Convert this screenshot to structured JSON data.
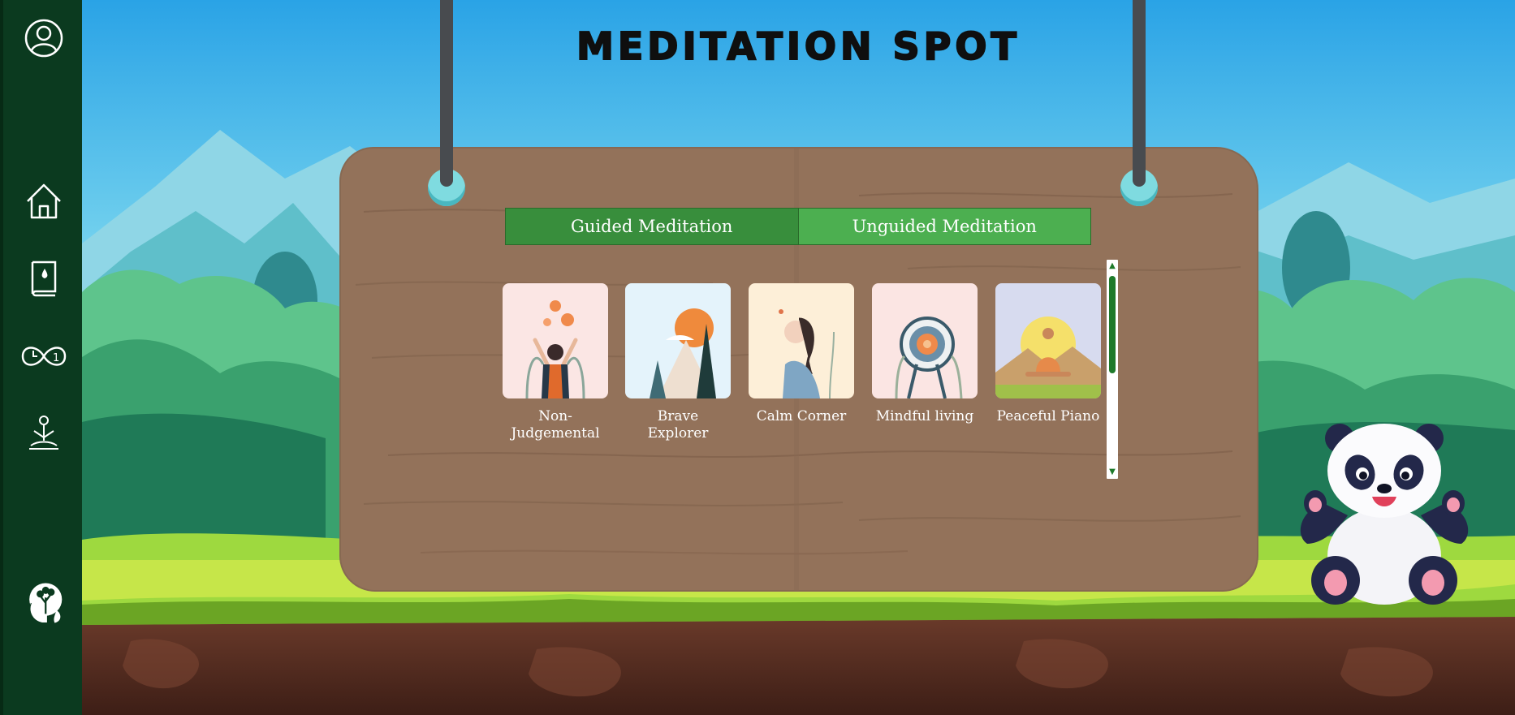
{
  "page": {
    "title": "MEDITATION SPOT"
  },
  "sidebar": {
    "items": [
      {
        "name": "profile",
        "icon": "user-circle-icon"
      },
      {
        "name": "home",
        "icon": "home-icon"
      },
      {
        "name": "journal",
        "icon": "book-drop-icon"
      },
      {
        "name": "timer",
        "icon": "infinity-clock-icon"
      },
      {
        "name": "meditation",
        "icon": "meditating-person-icon"
      },
      {
        "name": "mind",
        "icon": "head-tree-icon"
      }
    ]
  },
  "tabs": [
    {
      "label": "Guided Meditation",
      "active": true
    },
    {
      "label": "Unguided Meditation",
      "active": false
    }
  ],
  "cards": [
    {
      "label": "Non-\nJudgemental",
      "line1": "Non-",
      "line2": "Judgemental"
    },
    {
      "label": "Brave Explorer"
    },
    {
      "label": "Calm Corner"
    },
    {
      "label": "Mindful living"
    },
    {
      "label": "Peaceful Piano"
    }
  ],
  "colors": {
    "sidebar": "#0b3a1f",
    "tab_active": "#388e3c",
    "tab_inactive": "#4caf50",
    "board": "#93725a"
  }
}
